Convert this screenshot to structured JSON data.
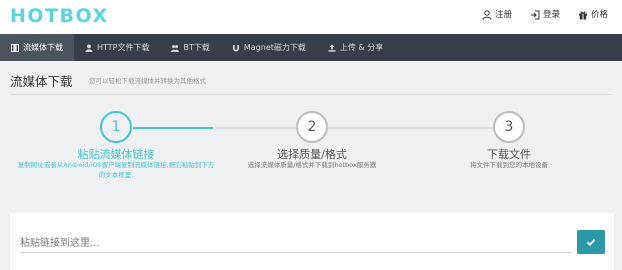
{
  "brand": {
    "logo": "HOTBOX"
  },
  "header": {
    "links": [
      {
        "label": "注册",
        "icon": "user-icon"
      },
      {
        "label": "登录",
        "icon": "sign-in-icon"
      },
      {
        "label": "价格",
        "icon": "gift-icon"
      }
    ]
  },
  "nav": {
    "items": [
      {
        "label": "流媒体下载",
        "icon": "film-icon",
        "active": true
      },
      {
        "label": "HTTP文件下载",
        "icon": "user-icon"
      },
      {
        "label": "BT下载",
        "icon": "users-icon"
      },
      {
        "label": "Magnet磁力下载",
        "icon": "magnet-icon"
      },
      {
        "label": "上传 & 分享",
        "icon": "upload-icon"
      }
    ]
  },
  "page": {
    "title": "流媒体下载",
    "subtitle": "您可以轻松下载流媒体并转换为其他格式"
  },
  "steps": [
    {
      "number": "1",
      "title": "粘贴流媒体链接",
      "description": "复制网址或者从Android/iOS客户端复制流媒体链接,把它粘贴到下方的文本框里.",
      "active": true
    },
    {
      "number": "2",
      "title": "选择质量/格式",
      "description": "选择流媒体质量/格式并下载到hotbox服务器",
      "active": false
    },
    {
      "number": "3",
      "title": "下载文件",
      "description": "将文件下载到您的本地设备",
      "active": false
    }
  ],
  "link_form": {
    "placeholder": "粘贴链接到这里...",
    "value": "",
    "submit_icon": "check-icon"
  },
  "colors": {
    "accent": "#46c3d0",
    "logo": "#5bd4df",
    "navbar": "#383e48",
    "nav_active": "#4c535f",
    "submit": "#2b9aa6"
  }
}
